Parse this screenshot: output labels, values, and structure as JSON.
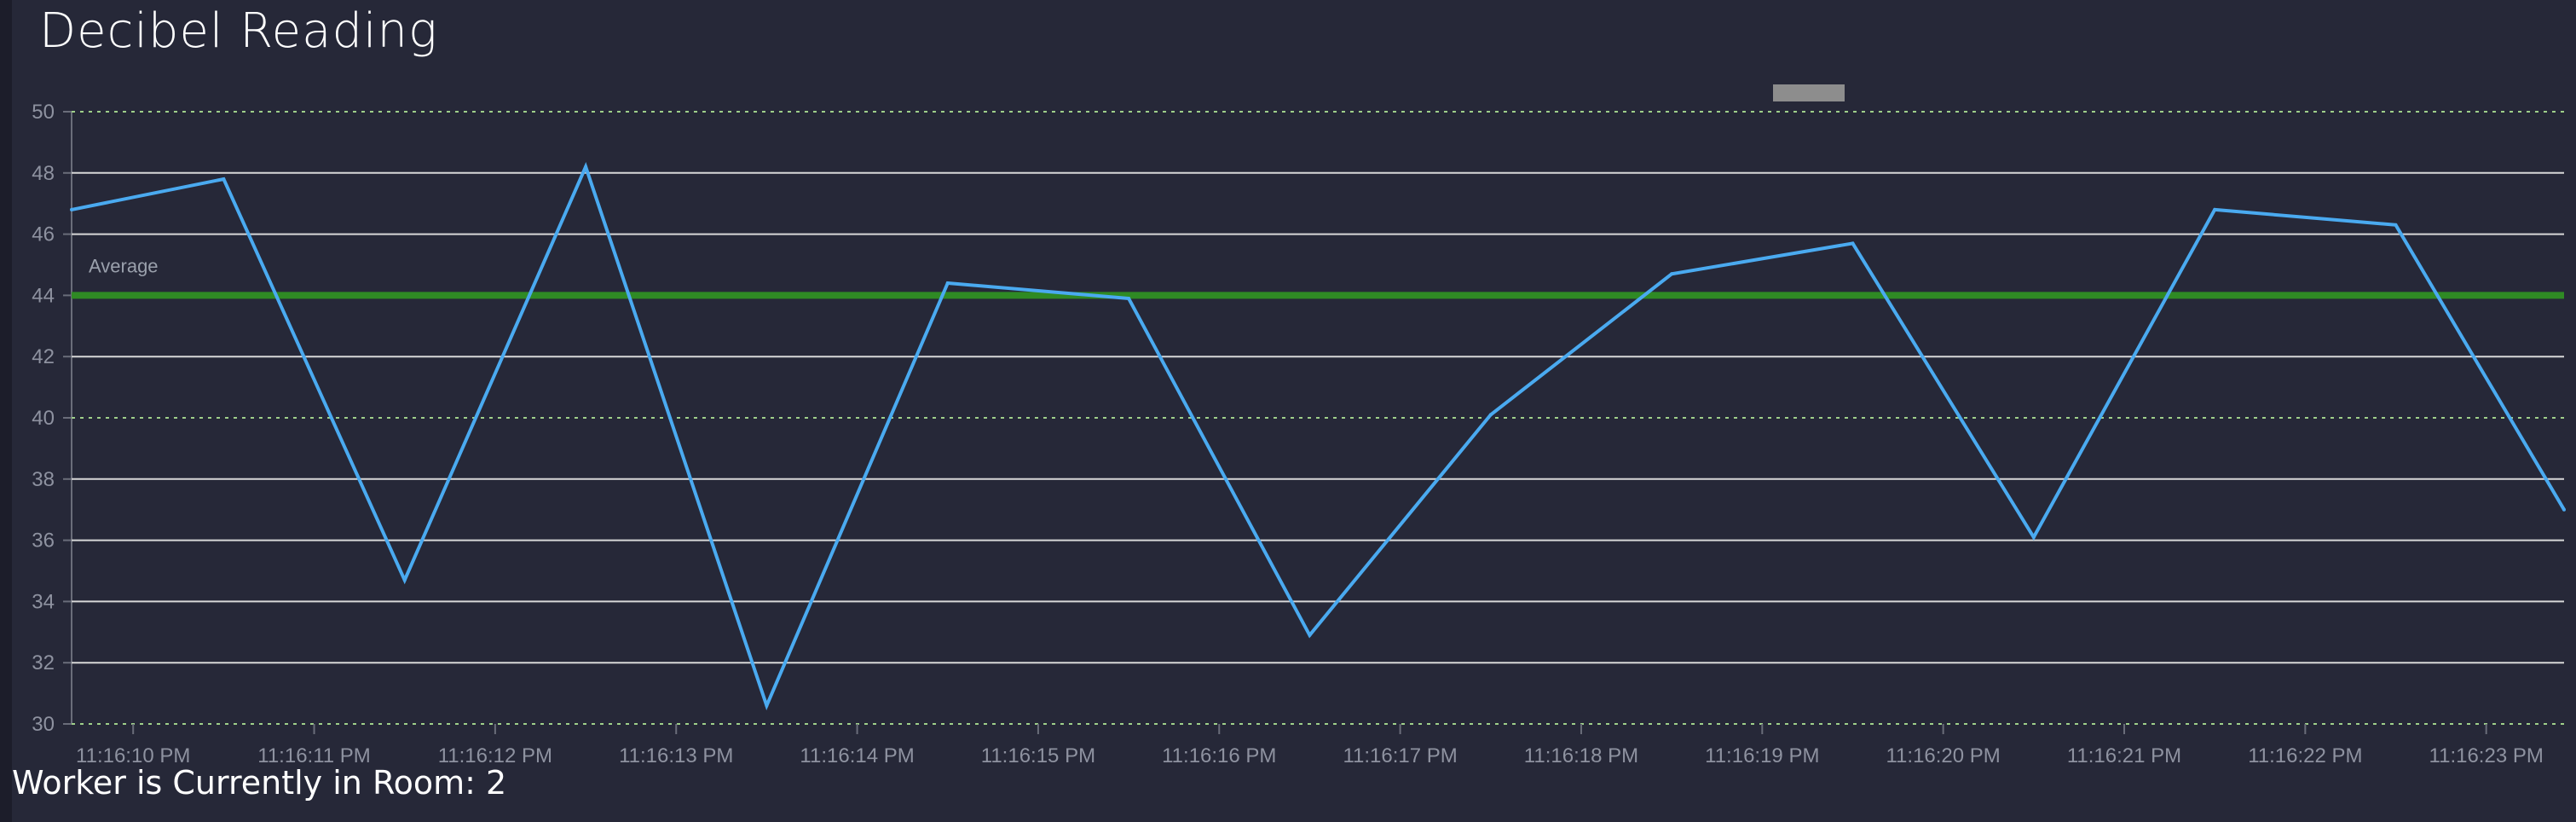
{
  "title": "Decibel Reading",
  "footer": "Worker is Currently in Room: 2",
  "colors": {
    "background": "#262838",
    "line": "#4aaaf0",
    "average": "#2f8a24",
    "threshold": "#9fd08a",
    "grid": "#d8d8d8"
  },
  "chart_data": {
    "type": "line",
    "title": "Decibel Reading",
    "xlabel": "",
    "ylabel": "",
    "ylim": [
      30,
      50
    ],
    "yticks": [
      30,
      32,
      34,
      36,
      38,
      40,
      42,
      44,
      46,
      48,
      50
    ],
    "xlim": [
      "11:16:09.66 PM",
      "11:16:23.43 PM"
    ],
    "xtick_labels": [
      "11:16:10 PM",
      "11:16:11 PM",
      "11:16:12 PM",
      "11:16:13 PM",
      "11:16:14 PM",
      "11:16:15 PM",
      "11:16:16 PM",
      "11:16:17 PM",
      "11:16:18 PM",
      "11:16:19 PM",
      "11:16:20 PM",
      "11:16:21 PM",
      "11:16:22 PM",
      "11:16:23 PM"
    ],
    "grid": true,
    "series": [
      {
        "points": [
          {
            "t": "11:16:09.66 PM",
            "y": 46.8
          },
          {
            "t": "11:16:10.5 PM",
            "y": 47.8
          },
          {
            "t": "11:16:11.5 PM",
            "y": 34.7
          },
          {
            "t": "11:16:12.5 PM",
            "y": 48.2
          },
          {
            "t": "11:16:13.5 PM",
            "y": 30.6
          },
          {
            "t": "11:16:14.5 PM",
            "y": 44.4
          },
          {
            "t": "11:16:15.5 PM",
            "y": 43.9
          },
          {
            "t": "11:16:16.5 PM",
            "y": 32.9
          },
          {
            "t": "11:16:17.5 PM",
            "y": 40.1
          },
          {
            "t": "11:16:18.5 PM",
            "y": 44.7
          },
          {
            "t": "11:16:19.5 PM",
            "y": 45.7
          },
          {
            "t": "11:16:20.5 PM",
            "y": 36.1
          },
          {
            "t": "11:16:21.5 PM",
            "y": 46.8
          },
          {
            "t": "11:16:22.5 PM",
            "y": 46.3
          },
          {
            "t": "11:16:23.43 PM",
            "y": 37.0
          }
        ]
      }
    ],
    "annotations": [
      {
        "label": "Average",
        "y": 44,
        "style": "solid"
      },
      {
        "label": "",
        "y": 50,
        "style": "dashed"
      },
      {
        "label": "",
        "y": 40,
        "style": "dashed"
      },
      {
        "label": "",
        "y": 30,
        "style": "dashed"
      }
    ]
  }
}
